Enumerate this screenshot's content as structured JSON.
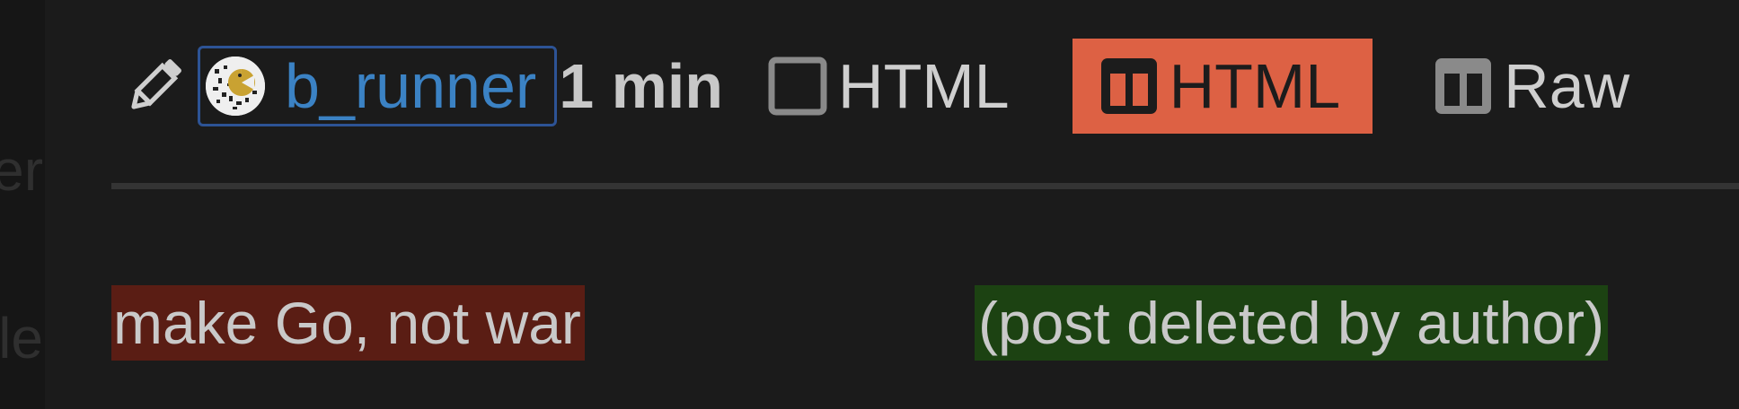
{
  "background_fragments": {
    "frag1": "er",
    "frag2": "le"
  },
  "header": {
    "edit_icon": "pencil-icon",
    "user": {
      "name": "b_runner",
      "avatar": "avatar-image"
    },
    "time_ago": "1 min",
    "view_buttons": [
      {
        "label": "HTML",
        "icon": "square-outline-icon",
        "active": false
      },
      {
        "label": "HTML",
        "icon": "split-view-icon",
        "active": true
      },
      {
        "label": "Raw",
        "icon": "split-view-icon",
        "active": false
      }
    ]
  },
  "diff": {
    "removed": "make Go, not war",
    "added": "(post deleted by author)"
  },
  "colors": {
    "background": "#1b1b1b",
    "username_link": "#3b82c4",
    "active_button": "#dd6144",
    "removed_bg": "#5a1d14",
    "added_bg": "#1c4212",
    "focus_border": "#2d5395"
  }
}
